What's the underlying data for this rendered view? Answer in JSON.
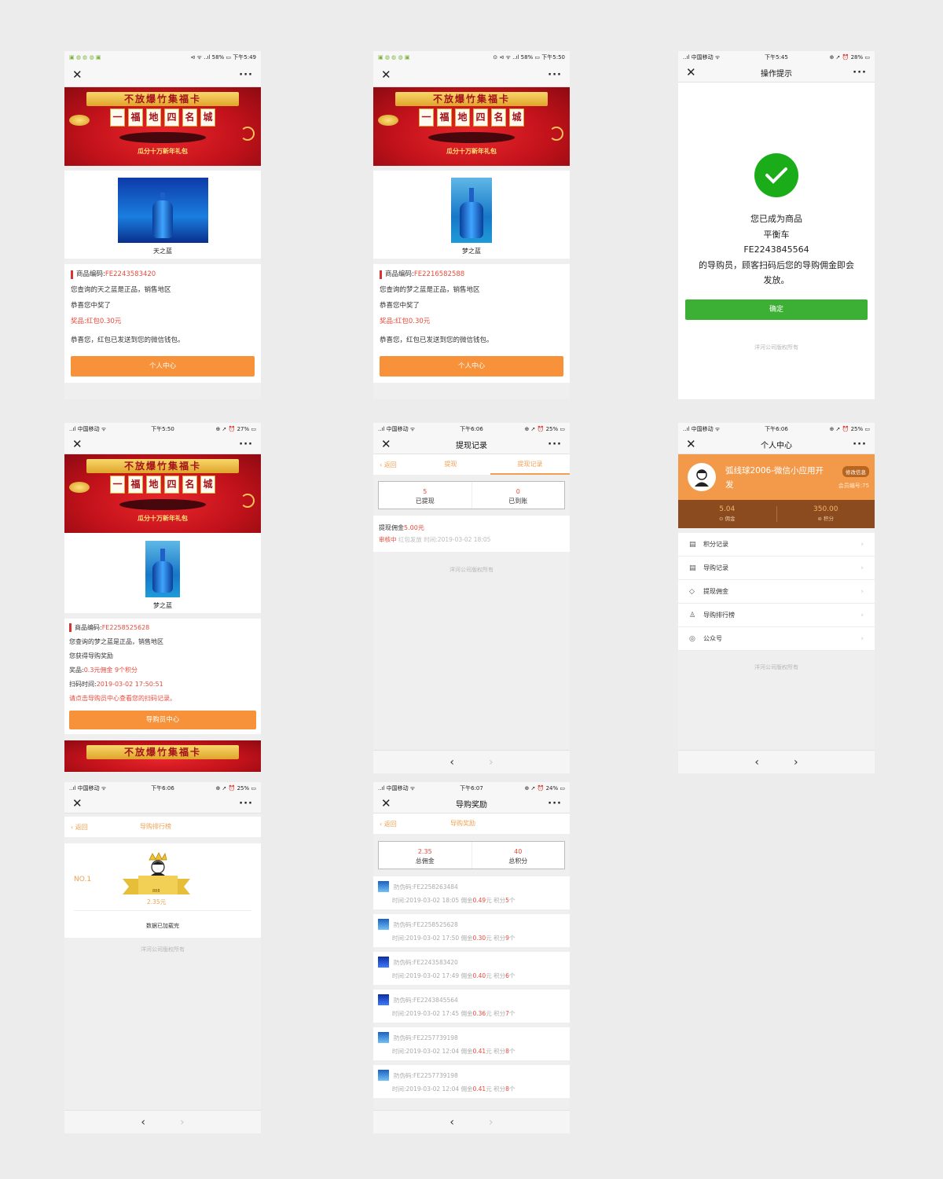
{
  "banner": {
    "ribbon": "不放爆竹集福卡",
    "tiles": [
      "一",
      "福",
      "地",
      "四",
      "名",
      "城"
    ],
    "sub": "瓜分十万新年礼包"
  },
  "common": {
    "close_icon": "close-icon",
    "more": "···",
    "copyright": "洋河公司版权所有",
    "back": "返回",
    "prev": "‹",
    "next": "›"
  },
  "screens": {
    "s1": {
      "status_left": "▣ ◍ ◍ ◍ ▣",
      "status_right": "⊲ ᯤ ..ıl 58% ▭ 下午5:49",
      "product_name": "天之蓝",
      "code_label": "商品编码:",
      "code_value": "FE2243583420",
      "line1": "您查询的天之蓝是正品，销售地区",
      "line2": "恭喜您中奖了",
      "prize": "奖品:红包0.30元",
      "line3": "恭喜您，红包已发送到您的微信钱包。",
      "button": "个人中心"
    },
    "s2": {
      "status_left": "▣ ◍ ◍ ◍ ▣",
      "status_right": "⊙ ⊲ ᯤ ..ıl 58% ▭ 下午5:50",
      "product_name": "梦之蓝",
      "code_label": "商品编码:",
      "code_value": "FE2216582588",
      "line1": "您查询的梦之蓝是正品，销售地区",
      "line2": "恭喜您中奖了",
      "prize": "奖品:红包0.30元",
      "line3": "恭喜您，红包已发送到您的微信钱包。",
      "button": "个人中心"
    },
    "s3": {
      "status_left": "..ıl 中国移动 ᯤ",
      "status_time": "下午5:45",
      "status_right": "⊕ ➚ ⏰ 28% ▭",
      "title": "操作提示",
      "msg1": "您已成为商品",
      "msg2": "平衡车",
      "msg3": "FE2243845564",
      "msg4": "的导购员，顾客扫码后您的导购佣金即会",
      "msg5": "发放。",
      "button": "确定"
    },
    "s4": {
      "status_left": "..ıl 中国移动 ᯤ",
      "status_time": "下午5:50",
      "status_right": "⊕ ➚ ⏰ 27% ▭",
      "product_name": "梦之蓝",
      "code_label": "商品编码:",
      "code_value": "FE2258525628",
      "line1": "您查询的梦之蓝是正品，销售地区",
      "line2": "您获得导购奖励",
      "prize_label": "奖品:",
      "prize_value": "0.3元佣金 9个积分",
      "time_label": "扫码时间:",
      "time_value": "2019-03-02 17:50:51",
      "hint": "请点击导购员中心查看您的扫码记录。",
      "button": "导购员中心"
    },
    "s5": {
      "status_left": "..ıl 中国移动 ᯤ",
      "status_time": "下午6:06",
      "status_right": "⊕ ➚ ⏰ 25% ▭",
      "title": "提现记录",
      "tab1": "提现",
      "tab2": "提现记录",
      "stat1_value": "5",
      "stat1_label": "已提现",
      "stat2_value": "0",
      "stat2_label": "已到账",
      "record_label": "提现佣金",
      "record_amount": "5.00元",
      "record_status": "审核中",
      "record_detail": "红包发放 时间:2019-03-02 18:05"
    },
    "s6": {
      "status_left": "..ıl 中国移动 ᯤ",
      "status_time": "下午6:06",
      "status_right": "⊕ ➚ ⏰ 25% ▭",
      "title": "个人中心",
      "user_name": "弧线球2006-微信小应用开发",
      "edit": "修改信息",
      "member_no": "会员编号:75",
      "commission_value": "5.04",
      "commission_label": "⊙ 佣金",
      "points_value": "350.00",
      "points_label": "⊜ 积分",
      "menu": [
        {
          "icon": "▤",
          "label": "积分记录"
        },
        {
          "icon": "▤",
          "label": "导购记录"
        },
        {
          "icon": "◇",
          "label": "提现佣金"
        },
        {
          "icon": "♙",
          "label": "导购排行榜"
        },
        {
          "icon": "◎",
          "label": "公众号"
        }
      ]
    },
    "s7": {
      "status_left": "..ıl 中国移动 ᯤ",
      "status_time": "下午6:06",
      "status_right": "⊕ ➚ ⏰ 25% ▭",
      "tab": "导购排行榜",
      "rank": "NO.1",
      "badge": "888",
      "amount": "2.35元",
      "loaded": "数据已加载完"
    },
    "s8": {
      "status_left": "..ıl 中国移动 ᯤ",
      "status_time": "下午6:07",
      "status_right": "⊕ ➚ ⏰ 24% ▭",
      "title": "导购奖励",
      "tab": "导购奖励",
      "stat1_value": "2.35",
      "stat1_label": "总佣金",
      "stat2_value": "40",
      "stat2_label": "总积分",
      "items": [
        {
          "code": "防伪码:FE2258263484",
          "time": "时间:2019-03-02 18:05 佣金",
          "amount": "0.49",
          "unit": "元 积分",
          "points": "5",
          "suffix": "个"
        },
        {
          "code": "防伪码:FE2258525628",
          "time": "时间:2019-03-02 17:50 佣金",
          "amount": "0.30",
          "unit": "元 积分",
          "points": "9",
          "suffix": "个"
        },
        {
          "code": "防伪码:FE2243583420",
          "time": "时间:2019-03-02 17:49 佣金",
          "amount": "0.40",
          "unit": "元 积分",
          "points": "6",
          "suffix": "个"
        },
        {
          "code": "防伪码:FE2243845564",
          "time": "时间:2019-03-02 17:45 佣金",
          "amount": "0.36",
          "unit": "元 积分",
          "points": "7",
          "suffix": "个"
        },
        {
          "code": "防伪码:FE2257739198",
          "time": "时间:2019-03-02 12:04 佣金",
          "amount": "0.41",
          "unit": "元 积分",
          "points": "8",
          "suffix": "个"
        },
        {
          "code": "防伪码:FE2257739198",
          "time": "时间:2019-03-02 12:04 佣金",
          "amount": "0.41",
          "unit": "元 积分",
          "points": "8",
          "suffix": "个"
        }
      ]
    }
  }
}
